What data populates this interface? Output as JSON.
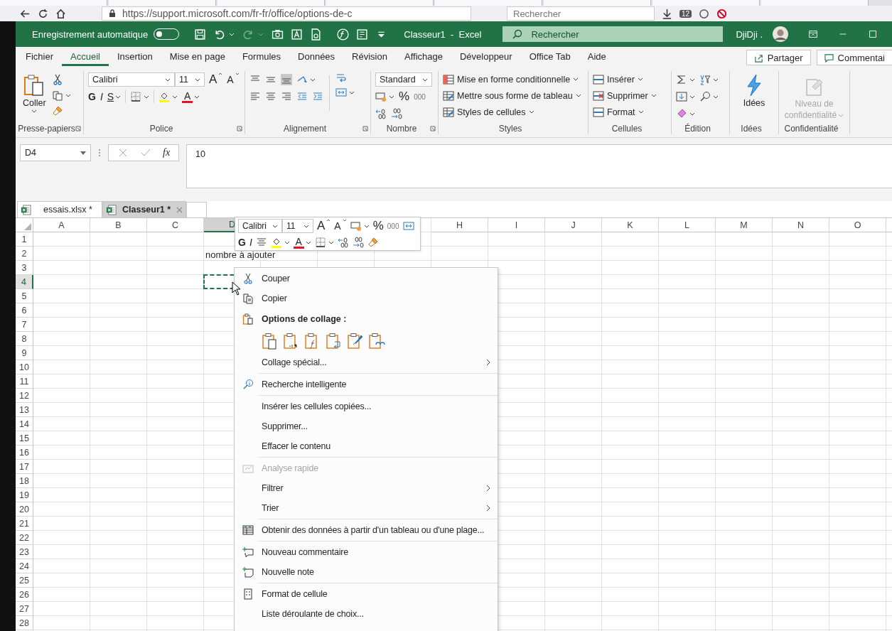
{
  "browser": {
    "url": "https://support.microsoft.com/fr-fr/office/options-de-c",
    "search": {
      "placeholder": "Rechercher"
    },
    "badge": "12"
  },
  "titlebar": {
    "autosave": {
      "label": "Enregistrement automatique",
      "on": false
    },
    "title": "Classeur1  -  Excel",
    "search": {
      "placeholder": "Rechercher"
    },
    "user": "DjiDji ."
  },
  "menu_tabs": [
    {
      "label": "Fichier",
      "selected": false
    },
    {
      "label": "Accueil",
      "selected": true
    },
    {
      "label": "Insertion",
      "selected": false
    },
    {
      "label": "Mise en page",
      "selected": false
    },
    {
      "label": "Formules",
      "selected": false
    },
    {
      "label": "Données",
      "selected": false
    },
    {
      "label": "Révision",
      "selected": false
    },
    {
      "label": "Affichage",
      "selected": false
    },
    {
      "label": "Développeur",
      "selected": false
    },
    {
      "label": "Office Tab",
      "selected": false
    },
    {
      "label": "Aide",
      "selected": false
    }
  ],
  "share_button": "Partager",
  "comments_button": "Commentai",
  "ribbon": {
    "clipboard": {
      "paste": "Coller",
      "group": "Presse-papiers"
    },
    "font": {
      "name": "Calibri",
      "size": "11",
      "grow": "A",
      "shrink": "A",
      "bold": "G",
      "italic": "I",
      "underline": "S",
      "font_color_button": "A",
      "group": "Police"
    },
    "alignment": {
      "group": "Alignement"
    },
    "number": {
      "format": "Standard",
      "percent": "%",
      "thousands": "000",
      "group": "Nombre"
    },
    "styles": {
      "items": [
        "Mise en forme conditionnelle",
        "Mettre sous forme de tableau",
        "Styles de cellules"
      ],
      "group": "Styles"
    },
    "cells": {
      "items": [
        "Insérer",
        "Supprimer",
        "Format"
      ],
      "group": "Cellules"
    },
    "editing": {
      "group": "Édition"
    },
    "ideas": {
      "button": "Idées",
      "group": "Idées"
    },
    "sensitivity": {
      "button": "Niveau de confidentialité",
      "disabled": true,
      "group": "Confidentialité"
    }
  },
  "formula_bar": {
    "name_box": "D4",
    "function_button": "fx",
    "value": "10"
  },
  "workbook_tabs": [
    {
      "label": "essais.xlsx *",
      "selected": false
    },
    {
      "label": "Classeur1 *",
      "selected": true
    }
  ],
  "sheet": {
    "columns": [
      {
        "label": "A",
        "selected": false
      },
      {
        "label": "B",
        "selected": false
      },
      {
        "label": "C",
        "selected": false
      },
      {
        "label": "D",
        "selected": true
      },
      {
        "label": "H",
        "selected": false
      },
      {
        "label": "I",
        "selected": false
      },
      {
        "label": "J",
        "selected": false
      },
      {
        "label": "K",
        "selected": false
      },
      {
        "label": "L",
        "selected": false
      },
      {
        "label": "M",
        "selected": false
      },
      {
        "label": "N",
        "selected": false
      },
      {
        "label": "O",
        "selected": false
      }
    ],
    "rows": [
      {
        "label": "1",
        "selected": false
      },
      {
        "label": "2",
        "selected": false
      },
      {
        "label": "3",
        "selected": false
      },
      {
        "label": "4",
        "selected": true
      },
      {
        "label": "5",
        "selected": false
      },
      {
        "label": "6",
        "selected": false
      },
      {
        "label": "7",
        "selected": false
      },
      {
        "label": "8",
        "selected": false
      },
      {
        "label": "9",
        "selected": false
      },
      {
        "label": "10",
        "selected": false
      },
      {
        "label": "11",
        "selected": false
      },
      {
        "label": "12",
        "selected": false
      },
      {
        "label": "13",
        "selected": false
      },
      {
        "label": "14",
        "selected": false
      },
      {
        "label": "15",
        "selected": false
      },
      {
        "label": "16",
        "selected": false
      },
      {
        "label": "17",
        "selected": false
      },
      {
        "label": "18",
        "selected": false
      },
      {
        "label": "19",
        "selected": false
      },
      {
        "label": "20",
        "selected": false
      },
      {
        "label": "21",
        "selected": false
      },
      {
        "label": "22",
        "selected": false
      },
      {
        "label": "23",
        "selected": false
      },
      {
        "label": "24",
        "selected": false
      },
      {
        "label": "25",
        "selected": false
      },
      {
        "label": "26",
        "selected": false
      },
      {
        "label": "27",
        "selected": false
      },
      {
        "label": "28",
        "selected": false
      }
    ],
    "cell_text": "nombre à ajouter"
  },
  "mini_toolbar": {
    "font": "Calibri",
    "size": "11",
    "grow": "A",
    "shrink": "A",
    "percent": "%",
    "thousands": "000",
    "bold": "G",
    "italic": "I",
    "font_color_button": "A"
  },
  "context_menu": [
    {
      "kind": "item",
      "label": "Couper",
      "disabled": false,
      "submenu": false
    },
    {
      "kind": "item",
      "label": "Copier",
      "disabled": false,
      "submenu": false
    },
    {
      "kind": "header",
      "label": "Options de collage :"
    },
    {
      "kind": "paste-options"
    },
    {
      "kind": "item",
      "label": "Collage spécial...",
      "disabled": false,
      "submenu": true
    },
    {
      "kind": "separator"
    },
    {
      "kind": "item",
      "label": "Recherche intelligente",
      "disabled": false,
      "submenu": false
    },
    {
      "kind": "separator"
    },
    {
      "kind": "item",
      "label": "Insérer les cellules copiées...",
      "disabled": false,
      "submenu": false
    },
    {
      "kind": "item",
      "label": "Supprimer...",
      "disabled": false,
      "submenu": false
    },
    {
      "kind": "item",
      "label": "Effacer le contenu",
      "disabled": false,
      "submenu": false
    },
    {
      "kind": "separator"
    },
    {
      "kind": "item",
      "label": "Analyse rapide",
      "disabled": true,
      "submenu": false
    },
    {
      "kind": "item",
      "label": "Filtrer",
      "disabled": false,
      "submenu": true
    },
    {
      "kind": "item",
      "label": "Trier",
      "disabled": false,
      "submenu": true
    },
    {
      "kind": "separator"
    },
    {
      "kind": "item",
      "label": "Obtenir des données à partir d'un tableau ou d'une plage...",
      "disabled": false,
      "submenu": false
    },
    {
      "kind": "separator"
    },
    {
      "kind": "item",
      "label": "Nouveau commentaire",
      "disabled": false,
      "submenu": false
    },
    {
      "kind": "item",
      "label": "Nouvelle note",
      "disabled": false,
      "submenu": false
    },
    {
      "kind": "separator"
    },
    {
      "kind": "item",
      "label": "Format de cellule",
      "disabled": false,
      "submenu": false
    },
    {
      "kind": "item",
      "label": "Liste déroulante de choix...",
      "disabled": false,
      "submenu": false
    }
  ]
}
